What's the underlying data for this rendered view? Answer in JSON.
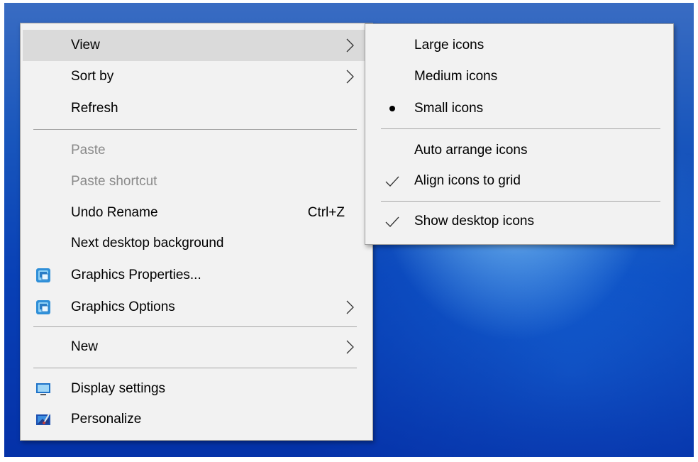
{
  "context_menu": {
    "items": [
      {
        "label": "View",
        "has_submenu": true,
        "highlighted": true
      },
      {
        "label": "Sort by",
        "has_submenu": true
      },
      {
        "label": "Refresh"
      },
      {
        "label": "Paste",
        "disabled": true
      },
      {
        "label": "Paste shortcut",
        "disabled": true
      },
      {
        "label": "Undo Rename",
        "shortcut": "Ctrl+Z"
      },
      {
        "label": "Next desktop background"
      },
      {
        "label": "Graphics Properties...",
        "icon": "graphics-icon"
      },
      {
        "label": "Graphics Options",
        "icon": "graphics-icon",
        "has_submenu": true
      },
      {
        "label": "New",
        "has_submenu": true
      },
      {
        "label": "Display settings",
        "icon": "display-icon"
      },
      {
        "label": "Personalize",
        "icon": "personalize-icon"
      }
    ]
  },
  "view_submenu": {
    "items": [
      {
        "label": "Large icons"
      },
      {
        "label": "Medium icons"
      },
      {
        "label": "Small icons",
        "mark": "bullet"
      },
      {
        "label": "Auto arrange icons"
      },
      {
        "label": "Align icons to grid",
        "mark": "check"
      },
      {
        "label": "Show desktop icons",
        "mark": "check"
      }
    ]
  },
  "colors": {
    "menu_background": "#f2f2f2",
    "highlight": "#dadada",
    "disabled_text": "#8a8a8a",
    "separator": "#a6a6a6"
  }
}
